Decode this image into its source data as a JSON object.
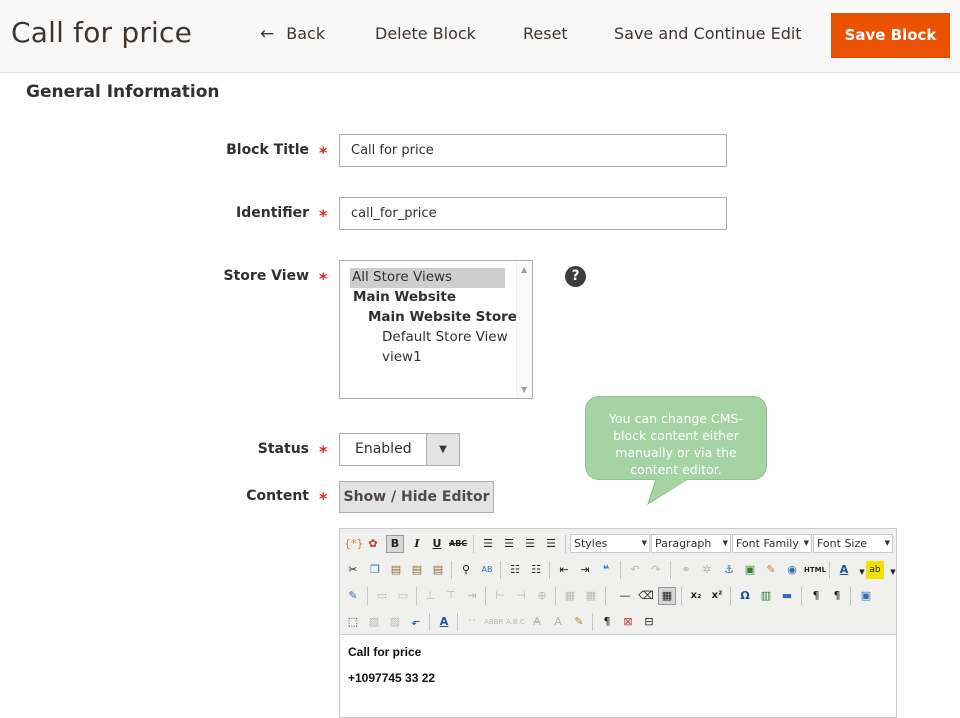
{
  "header": {
    "title": "Call for price",
    "back_label": "Back",
    "delete_label": "Delete Block",
    "reset_label": "Reset",
    "save_continue_label": "Save and Continue Edit",
    "save_label": "Save Block"
  },
  "section": {
    "title": "General Information"
  },
  "form": {
    "required_mark": "*",
    "block_title": {
      "label": "Block Title",
      "value": "Call for price"
    },
    "identifier": {
      "label": "Identifier",
      "value": "call_for_price"
    },
    "store_view": {
      "label": "Store View",
      "options": [
        "All Store Views",
        "Main Website",
        "Main Website Store",
        "Default Store View",
        "view1"
      ],
      "selected": "All Store Views"
    },
    "status": {
      "label": "Status",
      "value": "Enabled"
    },
    "content": {
      "label": "Content",
      "toggle_label": "Show / Hide Editor"
    }
  },
  "tooltip": {
    "text": "You can change CMS-block content either manually or via the content editor."
  },
  "editor": {
    "selects": {
      "styles": "Styles",
      "paragraph": "Paragraph",
      "font_family": "Font Family",
      "font_size": "Font Size"
    },
    "content_lines": [
      "Call for price",
      "+1097745 33 22"
    ]
  },
  "colors": {
    "accent": "#eb5202",
    "tooltip": "#a5d3a4",
    "required": "#e22626"
  }
}
